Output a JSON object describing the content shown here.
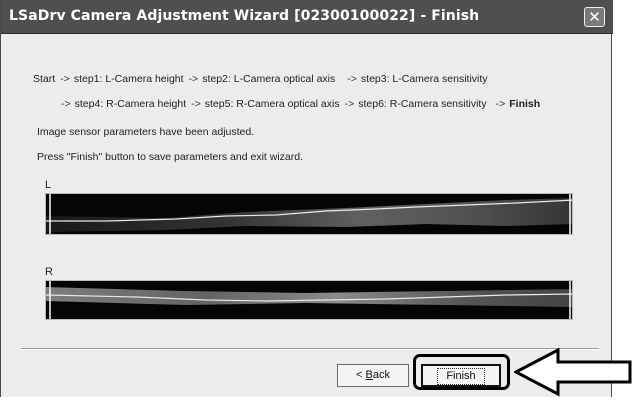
{
  "window": {
    "title": "LSaDrv Camera Adjustment Wizard [02300100022] - Finish",
    "close_glyph": "✕"
  },
  "steps": {
    "row1": [
      "Start",
      "step1: L-Camera height",
      "step2: L-Camera optical axis",
      "step3: L-Camera sensitivity"
    ],
    "row2": [
      "step4: R-Camera height",
      "step5: R-Camera optical axis",
      "step6: R-Camera sensitivity",
      "Finish"
    ],
    "arrow": "->"
  },
  "messages": {
    "line1": "Image sensor parameters have been adjusted.",
    "line2": "Press \"Finish\" button to save parameters and exit wizard."
  },
  "sensors": {
    "left_label": "L",
    "right_label": "R"
  },
  "buttons": {
    "back_prefix": "< ",
    "back_mnemonic": "B",
    "back_rest": "ack",
    "finish": "Finish"
  },
  "colors": {
    "titlebar": "#4f4f4f",
    "window_bg": "#ececec",
    "sensor_bg": "#050505",
    "highlight": "#000000"
  },
  "icons": {
    "close": "close-icon",
    "callout": "callout-arrow-icon"
  }
}
